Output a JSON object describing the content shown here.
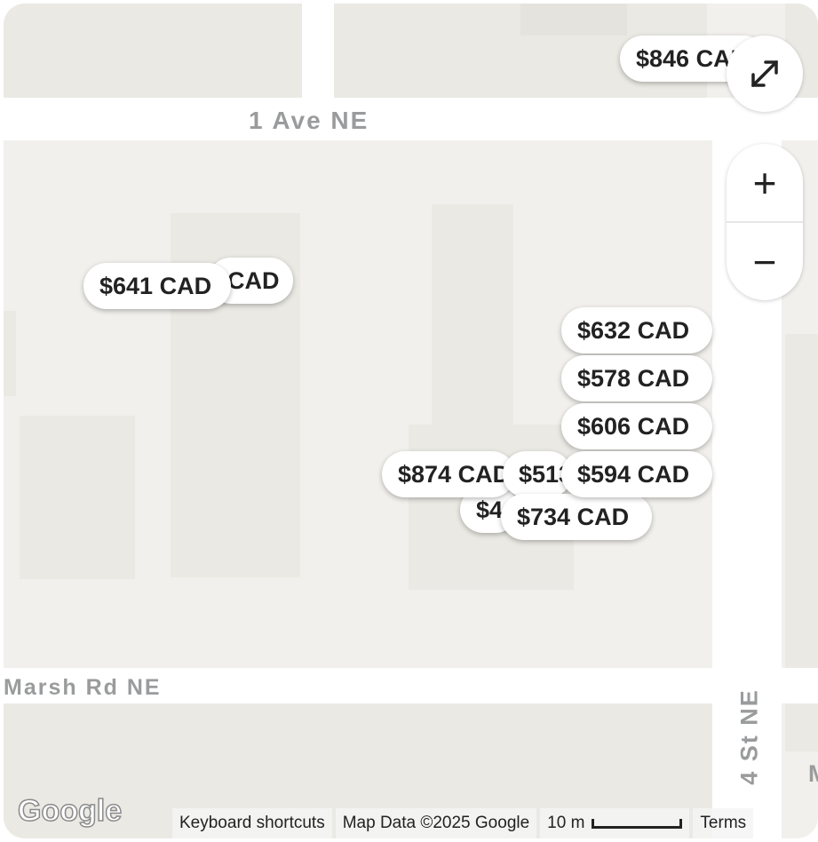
{
  "map": {
    "streets": {
      "top": "1 Ave NE",
      "bottom": "Marsh Rd NE",
      "right": "4 St NE",
      "far_right_partial": "M"
    },
    "logo": "Google",
    "controls": {
      "fullscreen_icon": "fullscreen-icon",
      "zoom_in": "+",
      "zoom_out": "−"
    },
    "attribution": {
      "shortcuts": "Keyboard shortcuts",
      "map_data": "Map Data ©2025 Google",
      "scale": "10 m",
      "terms": "Terms"
    }
  },
  "pins": [
    {
      "label": "$846 CAD"
    },
    {
      "label": "$641 CAD"
    },
    {
      "label": "CAD"
    },
    {
      "label": "$632 CAD"
    },
    {
      "label": "$578 CAD"
    },
    {
      "label": "$606 CAD"
    },
    {
      "label": "$874 CAD"
    },
    {
      "label": "$513"
    },
    {
      "label": "$594 CAD"
    },
    {
      "label": "$4"
    },
    {
      "label": "$734 CAD"
    }
  ]
}
